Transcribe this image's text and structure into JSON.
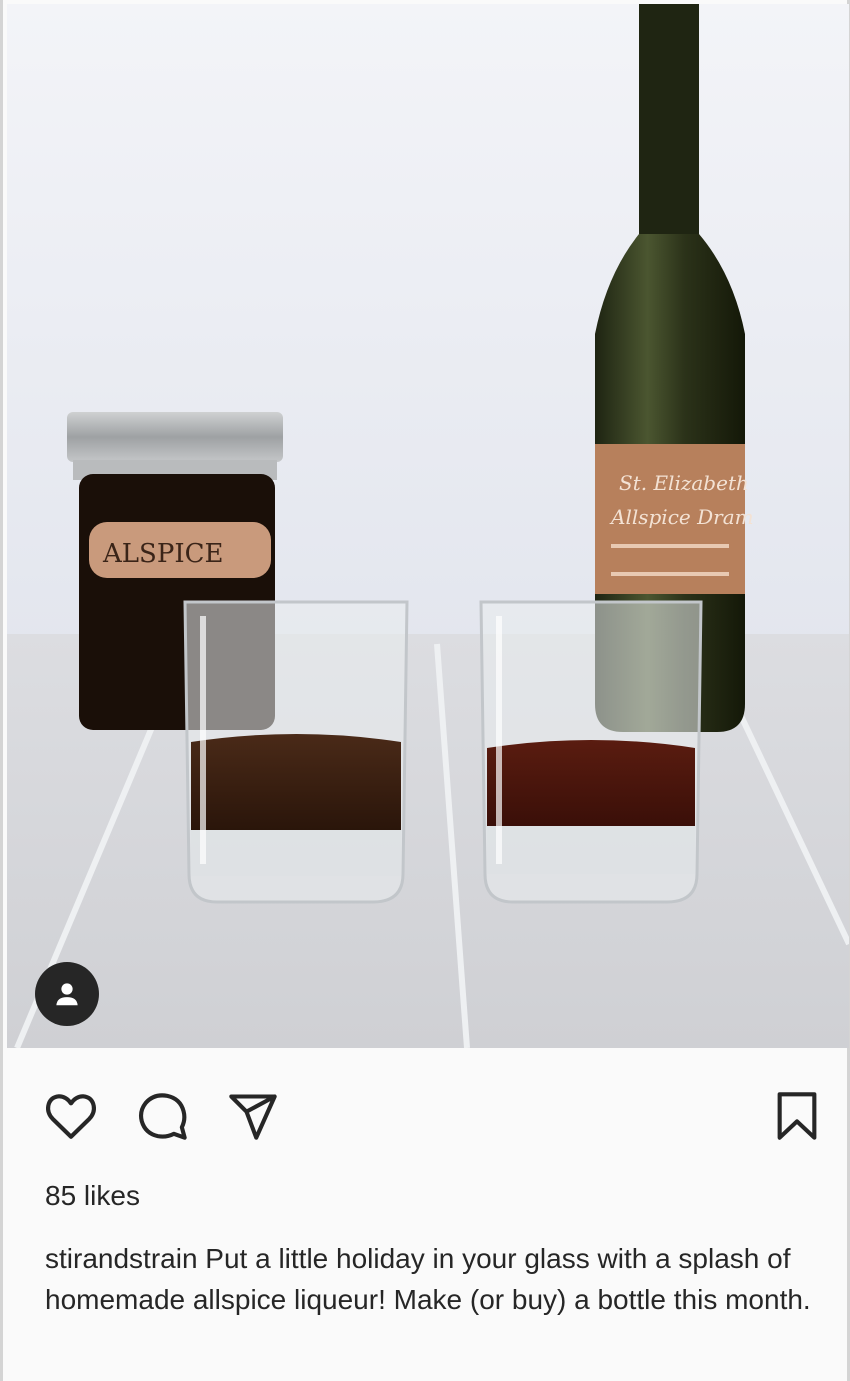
{
  "post": {
    "photo_alt": "",
    "jar_label": "ALSPICE",
    "bottle_label_line1": "St. Elizabeth",
    "bottle_label_line2": "Allspice Dram"
  },
  "icons": {
    "like": "heart-icon",
    "comment": "comment-icon",
    "share": "send-icon",
    "save": "bookmark-icon",
    "tag": "user-tag-icon"
  },
  "likes": {
    "text": "85 likes"
  },
  "caption": {
    "username": "stirandstrain",
    "text": " Put a little holiday in your glass with a splash of homemade allspice liqueur! Make (or buy) a bottle this month."
  },
  "colors": {
    "icon": "#262626",
    "background": "#fafafa"
  }
}
